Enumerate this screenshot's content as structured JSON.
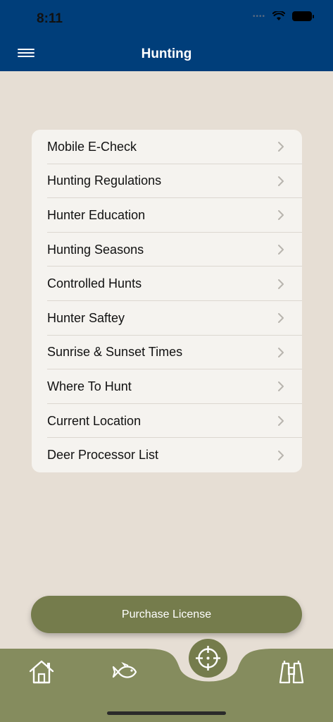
{
  "status_bar": {
    "time": "8:11"
  },
  "header": {
    "title": "Hunting"
  },
  "menu_items": [
    {
      "label": "Mobile E-Check"
    },
    {
      "label": "Hunting Regulations"
    },
    {
      "label": "Hunter Education"
    },
    {
      "label": "Hunting Seasons"
    },
    {
      "label": "Controlled Hunts"
    },
    {
      "label": "Hunter Saftey"
    },
    {
      "label": "Sunrise & Sunset Times"
    },
    {
      "label": "Where To Hunt"
    },
    {
      "label": "Current Location"
    },
    {
      "label": "Deer Processor List"
    }
  ],
  "purchase_button": {
    "label": "Purchase License"
  },
  "tab_bar": {
    "tabs": [
      {
        "icon": "home-icon"
      },
      {
        "icon": "fish-icon"
      },
      {
        "icon": "crosshair-icon"
      },
      {
        "icon": "binoculars-icon"
      }
    ]
  },
  "colors": {
    "header_bg": "#003E7A",
    "page_bg": "#E6DED4",
    "list_bg": "#F5F3EF",
    "accent_olive": "#757C4C",
    "tabbar_bg": "#858C5E"
  }
}
